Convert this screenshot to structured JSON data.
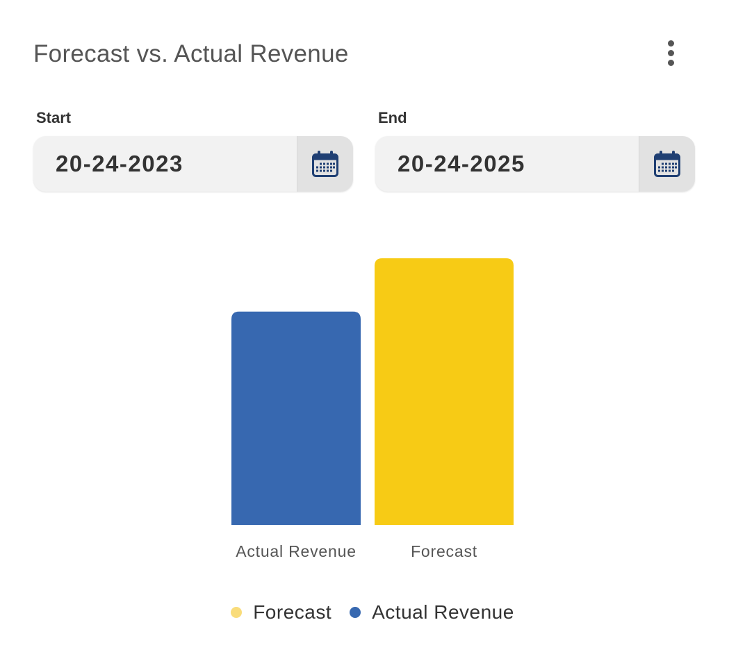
{
  "widget": {
    "title": "Forecast vs. Actual Revenue",
    "menu_icon": "more-vertical-icon"
  },
  "start": {
    "label": "Start",
    "value": "20-24-2023",
    "icon": "calendar-icon"
  },
  "end": {
    "label": "End",
    "value": "20-24-2025",
    "icon": "calendar-icon"
  },
  "colors": {
    "actual": "#3768b0",
    "forecast": "#f7cb15",
    "forecast_legend": "#f9dc7a",
    "calendar_icon": "#1f3f73"
  },
  "chart_data": {
    "type": "bar",
    "categories": [
      "Actual Revenue",
      "Forecast"
    ],
    "values": [
      80,
      100
    ],
    "ylim": [
      0,
      100
    ],
    "legend_position": "bottom",
    "legend": [
      {
        "name": "Forecast",
        "color": "#f9dc7a"
      },
      {
        "name": "Actual Revenue",
        "color": "#3768b0"
      }
    ]
  }
}
